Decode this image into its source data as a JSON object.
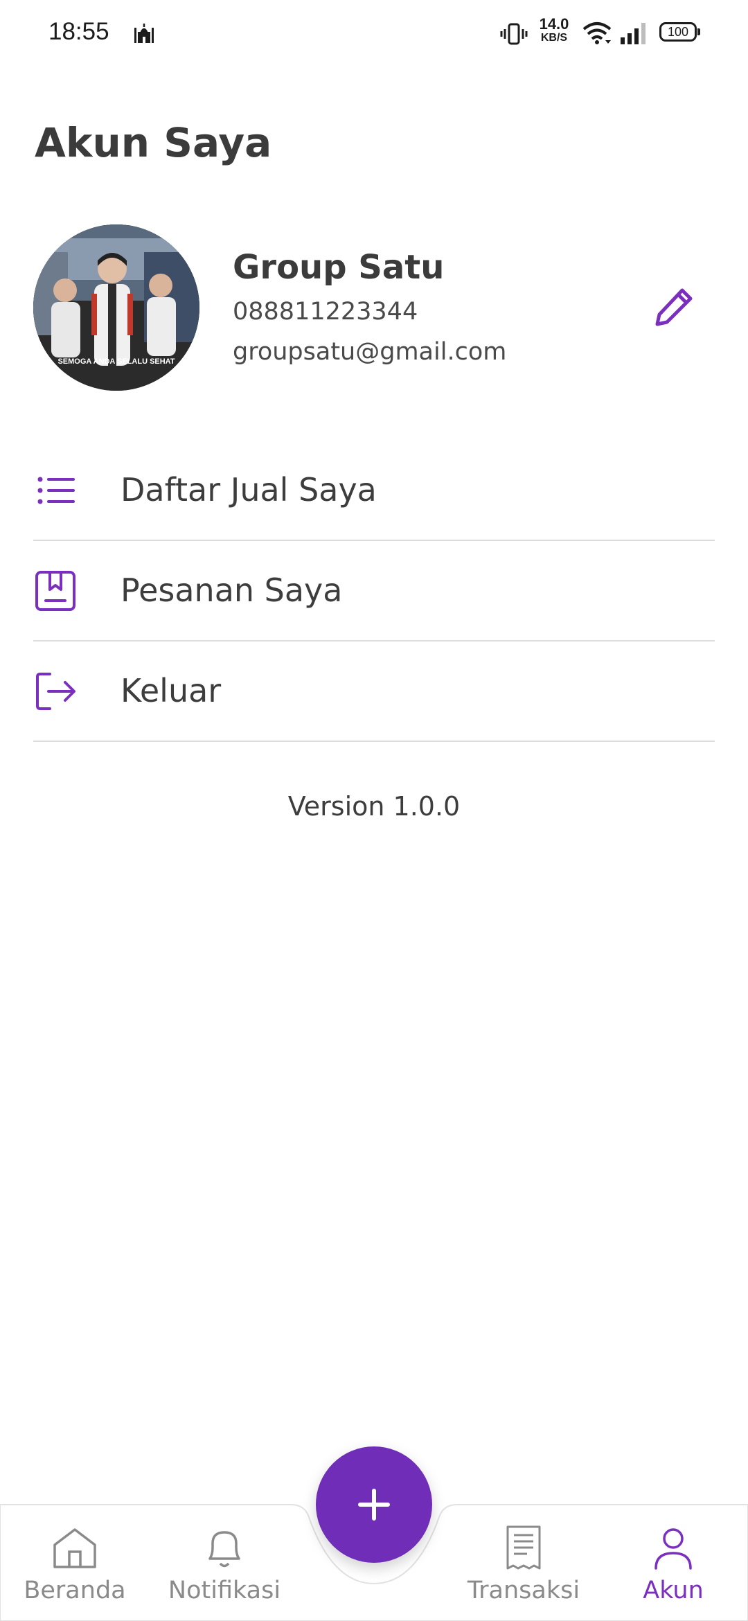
{
  "status_bar": {
    "time": "18:55",
    "net_speed_value": "14.0",
    "net_speed_unit": "KB/S",
    "battery_level": "100",
    "icons": [
      "mosque-icon",
      "vibrate-icon",
      "wifi-icon",
      "signal-icon",
      "battery-icon"
    ]
  },
  "header": {
    "title": "Akun Saya"
  },
  "profile": {
    "avatar_caption": "SEMOGA ANDA SELALU SEHAT",
    "name": "Group Satu",
    "phone": "088811223344",
    "email": "groupsatu@gmail.com",
    "edit_icon": "pencil-icon"
  },
  "menu": {
    "items": [
      {
        "label": "Daftar Jual Saya",
        "icon": "list-icon"
      },
      {
        "label": "Pesanan Saya",
        "icon": "bookmark-box-icon"
      },
      {
        "label": "Keluar",
        "icon": "logout-icon"
      }
    ]
  },
  "version": "Version 1.0.0",
  "bottom_nav": {
    "items": [
      {
        "label": "Beranda",
        "icon": "home-icon",
        "active": false
      },
      {
        "label": "Notifikasi",
        "icon": "bell-icon",
        "active": false
      },
      {
        "label": "Transaksi",
        "icon": "receipt-icon",
        "active": false
      },
      {
        "label": "Akun",
        "icon": "person-icon",
        "active": true
      }
    ],
    "fab_icon": "plus-icon"
  },
  "colors": {
    "accent": "#6f2db8",
    "accent_text": "#7b2fbe",
    "text": "#3d3d3d",
    "inactive": "#8a8a8a",
    "divider": "#dcdcdc"
  }
}
